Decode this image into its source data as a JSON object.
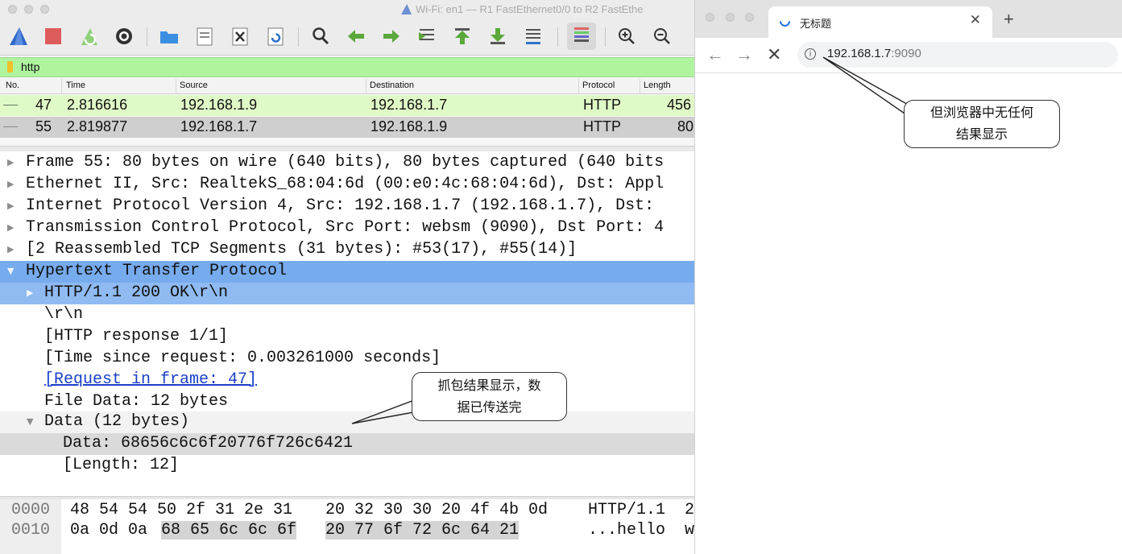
{
  "wireshark": {
    "title": "Wi-Fi: en1 — R1 FastEthernet0/0 to R2 FastEthe",
    "filter": "http",
    "columns": [
      "No.",
      "Time",
      "Source",
      "Destination",
      "Protocol",
      "Length"
    ],
    "packets": [
      {
        "no": "47",
        "time": "2.816616",
        "source": "192.168.1.9",
        "destination": "192.168.1.7",
        "protocol": "HTTP",
        "length": "456"
      },
      {
        "no": "55",
        "time": "2.819877",
        "source": "192.168.1.7",
        "destination": "192.168.1.9",
        "protocol": "HTTP",
        "length": "80"
      }
    ],
    "details": [
      "Frame 55: 80 bytes on wire (640 bits), 80 bytes captured (640 bits",
      "Ethernet II, Src: RealtekS_68:04:6d (00:e0:4c:68:04:6d), Dst: Appl",
      "Internet Protocol Version 4, Src: 192.168.1.7 (192.168.1.7), Dst: ",
      "Transmission Control Protocol, Src Port: websm (9090), Dst Port: 4",
      "[2 Reassembled TCP Segments (31 bytes): #53(17), #55(14)]",
      "Hypertext Transfer Protocol",
      "HTTP/1.1 200 OK\\r\\n",
      "\\r\\n",
      "[HTTP response 1/1]",
      "[Time since request: 0.003261000 seconds]",
      "[Request in frame: 47]",
      "File Data: 12 bytes",
      "Data (12 bytes)",
      "Data: 68656c6c6f20776f726c6421",
      "[Length: 12]"
    ],
    "hex": [
      {
        "offset": "0000",
        "bytes_a": "48 54 54 50 2f 31 2e 31",
        "bytes_b": "20 32 30 30 20 4f 4b 0d",
        "ascii": "HTTP/1.1  2"
      },
      {
        "offset": "0010",
        "bytes_a_plain": "0a 0d 0a ",
        "bytes_a_hl": "68 65 6c 6c 6f",
        "bytes_b": "20 77 6f 72 6c 64 21",
        "ascii": "...hello  w"
      }
    ]
  },
  "browser": {
    "tab_title": "无标题",
    "url_host": "192.168.1.7",
    "url_port": ":9090"
  },
  "annotations": {
    "browser_note_line1": "但浏览器中无任何",
    "browser_note_line2": "结果显示",
    "capture_note_line1": "抓包结果显示，数",
    "capture_note_line2": "据已传送完"
  }
}
